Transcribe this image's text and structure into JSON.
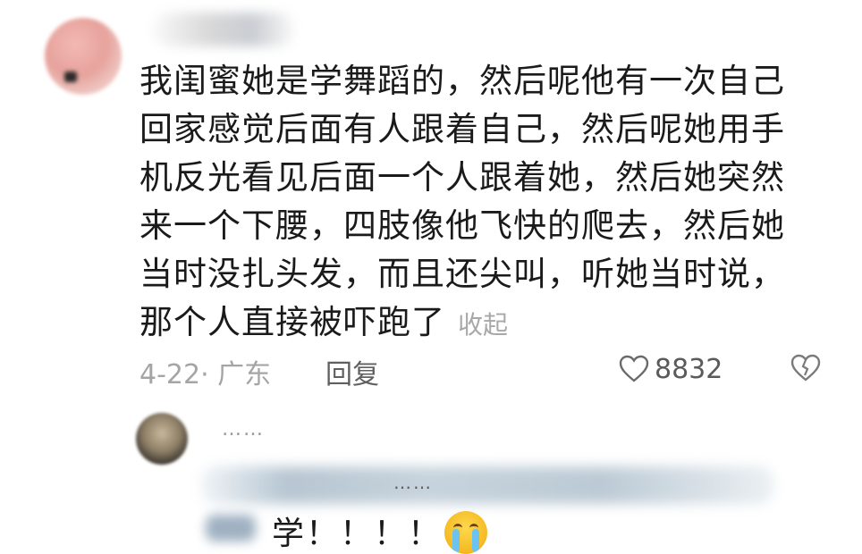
{
  "comment": {
    "text": "我闺蜜她是学舞蹈的，然后呢他有一次自己回家感觉后面有人跟着自己，然后呢她用手机反光看见后面一个人跟着她，然后她突然来一个下腰，四肢像他飞快的爬去，然后她当时没扎头发，而且还尖叫，听她当时说，那个人直接被吓跑了",
    "collapse_label": "收起",
    "date_location": "4-22· 广东",
    "reply_label": "回复",
    "like_count": "8832",
    "like_icon": "heart-outline-icon",
    "dislike_icon": "broken-heart-icon"
  },
  "reply": {
    "username": "……",
    "blurred_line_text": "……",
    "text": "学！！！！"
  },
  "colors": {
    "text": "#1a1a1a",
    "muted": "#a5a5a5",
    "reply_blur": "#b7c6d2"
  }
}
